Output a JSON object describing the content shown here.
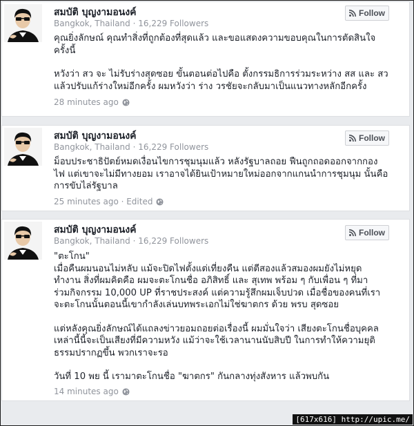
{
  "posts": [
    {
      "author": "สมบัติ บุญงามอนงค์",
      "location": "Bangkok, Thailand",
      "followers": "16,229 Followers",
      "follow_label": "Follow",
      "paragraphs": [
        "คุณยิ่งลักษณ์ คุณทำสิ่งที่ถูกต้องที่สุดแล้ว และขอแสดงความขอบคุณในการตัดสินใจ\nครั้งนี้",
        "หวังว่า สว จะ ไม่รับร่างสุดซอย ขั้นตอนต่อไปคือ ตั้งกรรมธิการร่วมระหว่าง สส และ สว\nแล้วปรับแก้ร่างใหม่อีกครั้ง ผมหวังว่า ร่าง วรชัยจะกลับมาเป็นแนวทางหลักอีกครั้ง"
      ],
      "time": "28 minutes ago"
    },
    {
      "author": "สมบัติ บุญงามอนงค์",
      "location": "Bangkok, Thailand",
      "followers": "16,229 Followers",
      "follow_label": "Follow",
      "paragraphs": [
        "ม็อบประชาธิปัตย์หมดเงื่อนไขการชุมนุมแล้ว หลังรัฐบาลถอย ฟืนถูกถอดออกจากกอง\nไฟ แต่เขาจะไม่มีทางยอม เราอาจได้ยินเป้าหมายใหม่ออกจากแกนนำการชุมนุม นั้นคือ\nการขับไล่รัฐบาล"
      ],
      "time": "25 minutes ago · Edited"
    },
    {
      "author": "สมบัติ บุญงามอนงค์",
      "location": "Bangkok, Thailand",
      "followers": "16,229 Followers",
      "follow_label": "Follow",
      "paragraphs": [
        "\"ตะโกน\"\nเมื่อคืนผมนอนไม่หลับ แม้จะปิดไฟตั้งแต่เที่ยงคืน แต่ตีสองแล้วสมองผมยังไม่หยุด\nทำงาน สิ่งที่ผมคิดคือ ผมจะตะโกนชื่อ อภิสิทธิ์ และ สุเทพ พร้อม ๆ กับเพื่อน ๆ ที่มา\nร่วมกิจกรรม 10,000 UP ที่ราชประสงค์ แต่ความรู้สึกผมเจ็บปวด เมื่อชื่อของคนที่เรา\nจะตะโกนนั้นตอนนี้เขากำลังเล่นบทพระเอกไม่ใช่ฆาตกร ด้วย พรบ สุดซอย",
        "แต่หลังคุณยิ่งลักษณ์ได้แถลงข่าวยอมถอยต่อเรื่องนี้ ผมมั่นใจว่า เสียงตะโกนชื่อบุคคล\nเหล่านี้นี้จะเป็นเสียงที่มีความหวัง แม้ว่าจะใช้เวลานานนับสิบปี ในการทำให้ความยุติ\nธรรมปรากฏขึ้น พวกเราจะรอ",
        "วันที่ 10 พย นี้ เรามาตะโกนชื่อ \"ฆาตกร\" กันกลางทุ่งสังหาร แล้วพบกัน"
      ],
      "time": "14 minutes ago"
    }
  ],
  "watermark": "[617x616] http://upic.me/",
  "icons": {
    "follow": "rss-icon",
    "privacy": "globe-icon"
  },
  "colors": {
    "meta": "#90949c",
    "text": "#1d2129",
    "button_bg": "#f6f7f9"
  }
}
